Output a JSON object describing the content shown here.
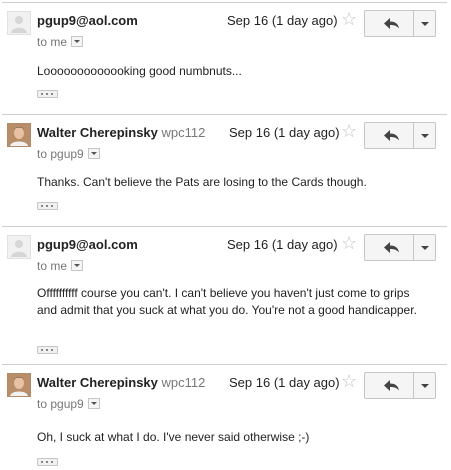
{
  "messages": [
    {
      "sender": "pgup9@aol.com",
      "sender_extra": "",
      "avatar": "default-avatar-icon",
      "to_line": "to me",
      "date": "Sep 16 (1 day ago)",
      "body": "Looooooooooooking good numbnuts..."
    },
    {
      "sender": "Walter Cherepinsky",
      "sender_extra": "wpc112",
      "avatar": "photo-avatar",
      "to_line": "to pgup9",
      "date": "Sep 16 (1 day ago)",
      "body": "Thanks. Can't believe the Pats are losing to the Cards though."
    },
    {
      "sender": "pgup9@aol.com",
      "sender_extra": "",
      "avatar": "default-avatar-icon",
      "to_line": "to me",
      "date": "Sep 16 (1 day ago)",
      "body": "Offffffffff course you can't. I can't believe you haven't just come to grips and admit that you suck at what you do. You're not a good handicapper."
    },
    {
      "sender": "Walter Cherepinsky",
      "sender_extra": "wpc112",
      "avatar": "photo-avatar",
      "to_line": "to pgup9",
      "date": "Sep 16 (1 day ago)",
      "body": "Oh, I suck at what I do. I've never said otherwise ;-)"
    }
  ],
  "icons": {
    "star": "star-icon",
    "reply": "reply-arrow-icon",
    "more": "chevron-down-icon",
    "to_dropdown": "small-dropdown-icon",
    "ellipsis": "show-trimmed-content-icon"
  },
  "colors": {
    "text": "#222222",
    "muted": "#777777",
    "divider": "#cfcfcf",
    "button_bg": "#f5f5f5",
    "button_border": "#c6c6c6",
    "star": "#c3c3c3"
  }
}
